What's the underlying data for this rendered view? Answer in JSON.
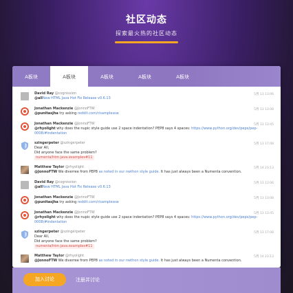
{
  "hero": {
    "title": "社区动态",
    "subtitle": "探索最火热的社区动态"
  },
  "tabs": [
    {
      "label": "A板块",
      "active": false
    },
    {
      "label": "A板块",
      "active": true
    },
    {
      "label": "A板块",
      "active": false
    },
    {
      "label": "A板块",
      "active": false
    },
    {
      "label": "A板块",
      "active": false
    }
  ],
  "feed": [
    {
      "avatar": "grey-avatar",
      "name": "David Ray",
      "handle": "@cognission",
      "time": "5月 13 13:06",
      "lines": [
        {
          "mention": "@all",
          "text": "",
          "link": "New HTML Java Hot Fix Release v0.6.13",
          "after": "",
          "code": ""
        }
      ]
    },
    {
      "avatar": "ring-avatar",
      "name": "Jonathan Mackenzie",
      "handle": "@JonnoFTW",
      "time": "5月 13 13:08",
      "lines": [
        {
          "mention": "@punitasjha",
          "text": " try asking ",
          "link": "reddit.com/r/samplessw",
          "after": "",
          "code": ""
        }
      ]
    },
    {
      "avatar": "ring-avatar",
      "name": "Jonathan Mackenzie",
      "handle": "@JonnoFTW",
      "time": "5月 13 13:45",
      "lines": [
        {
          "mention": "@rhyolight",
          "text": " why does the nupic style guide use 2 space indentation? PEP8 says 4 spaces: ",
          "link": "https://www.python.org/dev/peps/pep-0008/#indentation",
          "after": "",
          "code": ""
        }
      ]
    },
    {
      "avatar": "shield-avatar",
      "name": "szingerpeter",
      "handle": "@szingerpeter",
      "time": "5月 13 17:08",
      "lines": [
        {
          "mention": "",
          "text": "Dear All,",
          "link": "",
          "after": "",
          "code": ""
        },
        {
          "mention": "",
          "text": "Did anyone face the same problem?",
          "link": "",
          "after": "",
          "code": ""
        },
        {
          "mention": "",
          "text": "",
          "link": "",
          "after": "",
          "code": "numenta/htm.java.examples#11"
        }
      ]
    },
    {
      "avatar": "photo-avatar",
      "name": "Matthew Taylor",
      "handle": "@rhyolight",
      "time": "5月 14 23:13",
      "lines": [
        {
          "mention": "@JonnoFTW",
          "text": " We diverree from PEP8 ",
          "link": "as noted in our nwthon style guide.",
          "after": " It has just always been a Numenta convention.",
          "code": ""
        }
      ]
    },
    {
      "avatar": "grey-avatar",
      "name": "David Ray",
      "handle": "@cognission",
      "time": "5月 13 13:06",
      "lines": [
        {
          "mention": "@all",
          "text": "",
          "link": "New HTML Java Hot Fix Release v0.6.13",
          "after": "",
          "code": ""
        }
      ]
    },
    {
      "avatar": "ring-avatar",
      "name": "Jonathan Mackenzie",
      "handle": "@JonnoFTW",
      "time": "5月 13 13:08",
      "lines": [
        {
          "mention": "@punitasjha",
          "text": " try asking ",
          "link": "reddit.com/r/samplessw",
          "after": "",
          "code": ""
        }
      ]
    },
    {
      "avatar": "ring-avatar",
      "name": "Jonathan Mackenzie",
      "handle": "@JonnoFTW",
      "time": "5月 13 13:45",
      "lines": [
        {
          "mention": "@rhyolight",
          "text": " why does the nupic style guide use 2 space indentation? PEP8 says 4 spaces: ",
          "link": "https://www.python.org/dev/peps/pep-0008/#indentation",
          "after": "",
          "code": ""
        }
      ]
    },
    {
      "avatar": "shield-avatar",
      "name": "szingerpeter",
      "handle": "@szingerpeter",
      "time": "5月 13 17:08",
      "lines": [
        {
          "mention": "",
          "text": "Dear All,",
          "link": "",
          "after": "",
          "code": ""
        },
        {
          "mention": "",
          "text": "Did anyone face the same problem?",
          "link": "",
          "after": "",
          "code": ""
        },
        {
          "mention": "",
          "text": "",
          "link": "",
          "after": "",
          "code": "numenta/htm.java.examples#11"
        }
      ]
    },
    {
      "avatar": "photo-avatar",
      "name": "Matthew Taylor",
      "handle": "@rhyolight",
      "time": "5月 14 23:13",
      "lines": [
        {
          "mention": "@JonnoFTW",
          "text": " We diverree from PEP8 ",
          "link": "as noted in our nwthon style guide.",
          "after": " It has just always been a Numenta convention.",
          "code": ""
        }
      ]
    }
  ],
  "footer": {
    "join_label": "加入讨论",
    "register_label": "注册并讨论"
  },
  "colors": {
    "accent": "#f5a623",
    "tab_bar": "#8f7cc4",
    "link": "#4a7fd0",
    "code": "#d9534f"
  }
}
